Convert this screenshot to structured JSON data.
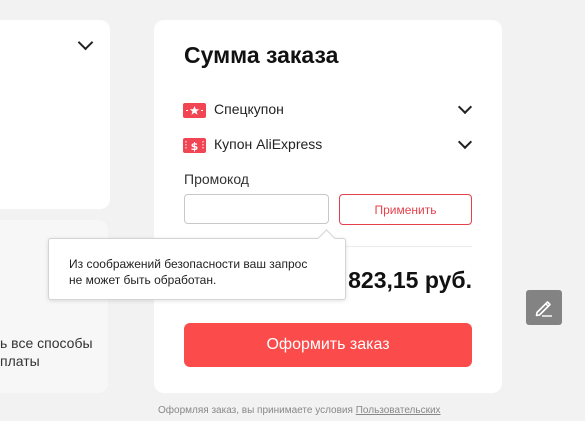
{
  "order_summary": {
    "title": "Сумма заказа",
    "coupons": [
      {
        "label": "Спецкупон",
        "icon": "special-coupon-icon"
      },
      {
        "label": "Купон AliExpress",
        "icon": "aliexpress-coupon-icon"
      }
    ],
    "promo": {
      "label": "Промокод",
      "value": "",
      "placeholder": "",
      "apply_label": "Применить"
    },
    "total": "823,15 руб.",
    "checkout_label": "Оформить заказ"
  },
  "tooltip": {
    "line1": "Из соображений безопасности ваш запрос",
    "line2": "не может быть обработан."
  },
  "payment_panel": {
    "line1": "ь все способы",
    "line2": "платы"
  },
  "footer": {
    "text": "Оформляя заказ, вы принимаете условия",
    "link": "Пользовательских"
  },
  "colors": {
    "accent": "#fb4b4b",
    "outline_red": "#e5414c",
    "coupon_red": "#f24553",
    "edit_button": "#838383"
  }
}
